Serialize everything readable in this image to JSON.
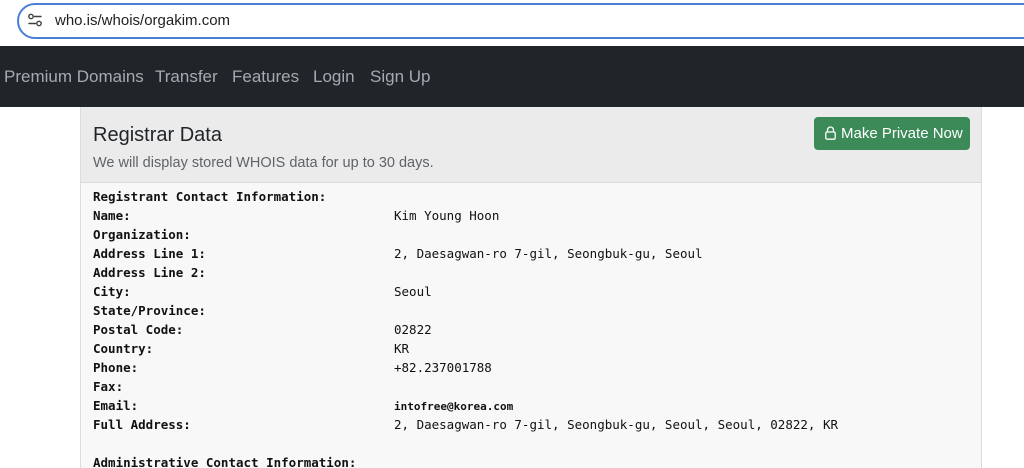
{
  "browser": {
    "url": "who.is/whois/orgakim.com"
  },
  "navbar": {
    "items": [
      "Premium Domains",
      "Transfer",
      "Features",
      "Login",
      "Sign Up"
    ]
  },
  "registrar_panel": {
    "title": "Registrar Data",
    "subtitle": "We will display stored WHOIS data for up to 30 days.",
    "private_button_label": "Make Private Now"
  },
  "registrant": {
    "heading": "Registrant Contact Information:",
    "rows": [
      {
        "label": "Name:",
        "value": "Kim Young Hoon"
      },
      {
        "label": "Organization:",
        "value": ""
      },
      {
        "label": "Address Line 1:",
        "value": "2, Daesagwan-ro 7-gil, Seongbuk-gu, Seoul"
      },
      {
        "label": "Address Line 2:",
        "value": ""
      },
      {
        "label": "City:",
        "value": "Seoul"
      },
      {
        "label": "State/Province:",
        "value": ""
      },
      {
        "label": "Postal Code:",
        "value": "02822"
      },
      {
        "label": "Country:",
        "value": "KR"
      },
      {
        "label": "Phone:",
        "value": "+82.237001788"
      },
      {
        "label": "Fax:",
        "value": ""
      },
      {
        "label": "Email:",
        "value": "intofree@korea.com"
      },
      {
        "label": "Full Address:",
        "value": "2, Daesagwan-ro 7-gil, Seongbuk-gu, Seoul, Seoul, 02822, KR"
      }
    ]
  },
  "administrative": {
    "heading": "Administrative Contact Information:"
  },
  "colors": {
    "navbar_bg": "#212529",
    "button_green": "#3b8a57",
    "address_border": "#4a7fd6"
  }
}
